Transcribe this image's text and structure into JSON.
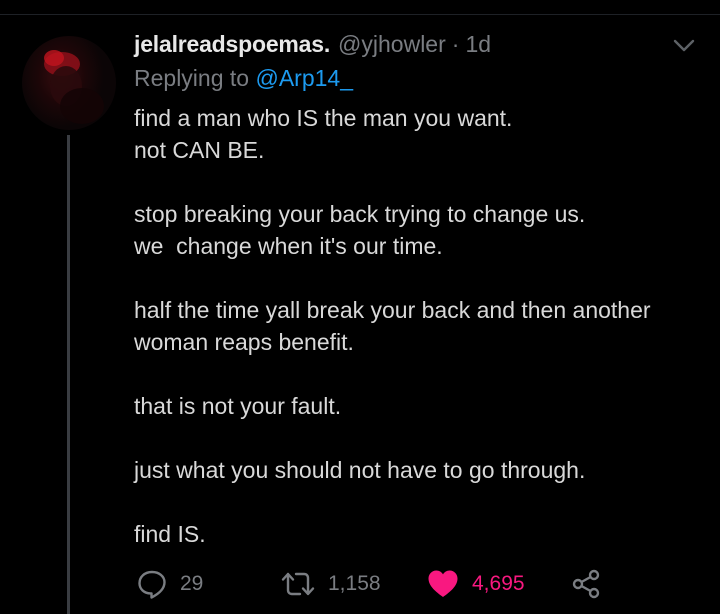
{
  "tweet": {
    "display_name": "jelalreadspoemas.",
    "handle": "@yjhowler",
    "separator": "·",
    "age": "1d",
    "reply_prefix": "Replying to",
    "reply_to": "@Arp14_",
    "body_lines": [
      "find a man who IS the man you want.",
      "not CAN BE.",
      "",
      "stop breaking your back trying to change us.",
      "we  change when it's our time.",
      "",
      "half the time yall break your back and then another",
      "woman reaps benefit.",
      "",
      "that is not your fault.",
      "",
      "just what you should not have to go through.",
      "",
      "find IS."
    ]
  },
  "actions": {
    "reply": {
      "icon": "reply-icon",
      "count": "29"
    },
    "retweet": {
      "icon": "retweet-icon",
      "count": "1,158"
    },
    "like": {
      "icon": "heart-icon",
      "count": "4,695",
      "liked": true
    },
    "share": {
      "icon": "share-icon"
    }
  },
  "colors": {
    "background": "#000000",
    "text": "#d9d9d9",
    "muted": "#7a7d82",
    "link": "#1d9bf0",
    "like": "#f91880"
  }
}
